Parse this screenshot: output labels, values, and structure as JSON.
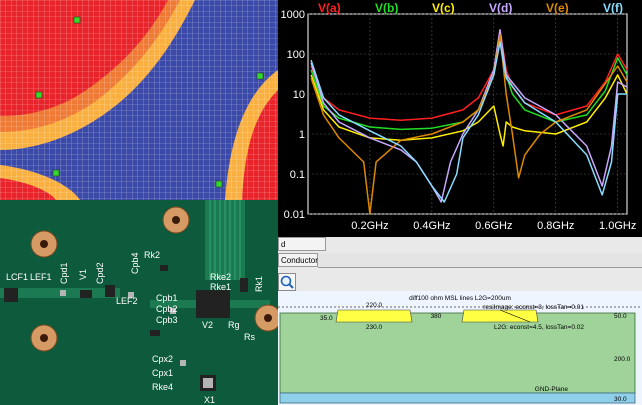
{
  "chart_data": {
    "type": "line",
    "title": "",
    "xlabel": "",
    "ylabel": "",
    "x_tick_labels": [
      "0.2GHz",
      "0.4GHz",
      "0.6GHz",
      "0.8GHz",
      "1.0GHz"
    ],
    "y_tick_labels": [
      "1000",
      "100",
      "10",
      "1",
      "0.1",
      "0.01"
    ],
    "xlim": [
      0.0,
      1.03
    ],
    "ylim": [
      0.01,
      1000
    ],
    "log_y": true,
    "grid": true,
    "legend_position": "top",
    "series": [
      {
        "name": "V(a)",
        "color": "#ff2020",
        "x": [
          0.01,
          0.05,
          0.1,
          0.2,
          0.3,
          0.4,
          0.5,
          0.55,
          0.6,
          0.62,
          0.64,
          0.66,
          0.7,
          0.8,
          0.9,
          0.96,
          1.0,
          1.03
        ],
        "y": [
          50,
          8,
          4,
          2.5,
          2.2,
          2.5,
          4,
          8,
          40,
          400,
          40,
          15,
          6,
          3,
          5,
          20,
          100,
          40
        ]
      },
      {
        "name": "V(b)",
        "color": "#22dd22",
        "x": [
          0.01,
          0.05,
          0.1,
          0.2,
          0.3,
          0.4,
          0.5,
          0.55,
          0.6,
          0.62,
          0.64,
          0.66,
          0.7,
          0.8,
          0.9,
          0.96,
          1.0,
          1.03
        ],
        "y": [
          40,
          5,
          2.5,
          1.5,
          1.3,
          1.4,
          2,
          4,
          30,
          300,
          30,
          10,
          4,
          2,
          3,
          12,
          80,
          30
        ]
      },
      {
        "name": "V(c)",
        "color": "#ffee00",
        "x": [
          0.01,
          0.05,
          0.1,
          0.2,
          0.3,
          0.4,
          0.5,
          0.55,
          0.6,
          0.62,
          0.63,
          0.64,
          0.66,
          0.7,
          0.8,
          0.9,
          0.96,
          1.0,
          1.03
        ],
        "y": [
          30,
          4,
          1.5,
          0.8,
          0.7,
          0.8,
          1.2,
          2,
          5,
          1,
          0.5,
          2,
          1.5,
          1.2,
          1,
          2,
          8,
          30,
          10
        ]
      },
      {
        "name": "V(d)",
        "color": "#c8a8ff",
        "x": [
          0.01,
          0.05,
          0.1,
          0.2,
          0.3,
          0.35,
          0.4,
          0.43,
          0.46,
          0.5,
          0.55,
          0.6,
          0.62,
          0.64,
          0.7,
          0.8,
          0.9,
          0.95,
          0.98,
          1.0,
          1.03
        ],
        "y": [
          60,
          6,
          2,
          0.8,
          0.4,
          0.2,
          0.05,
          0.02,
          0.2,
          1,
          4,
          40,
          400,
          30,
          8,
          3,
          0.5,
          0.05,
          0.5,
          20,
          15
        ]
      },
      {
        "name": "V(e)",
        "color": "#dd8800",
        "x": [
          0.01,
          0.05,
          0.1,
          0.18,
          0.2,
          0.22,
          0.3,
          0.4,
          0.5,
          0.55,
          0.6,
          0.62,
          0.64,
          0.66,
          0.68,
          0.7,
          0.75,
          0.8,
          0.9,
          1.0,
          1.03
        ],
        "y": [
          25,
          3,
          0.8,
          0.2,
          0.01,
          0.2,
          0.7,
          1,
          2,
          4,
          30,
          300,
          10,
          1,
          0.08,
          0.3,
          1,
          2,
          4,
          50,
          20
        ]
      },
      {
        "name": "V(f)",
        "color": "#88ddff",
        "x": [
          0.01,
          0.05,
          0.1,
          0.2,
          0.3,
          0.35,
          0.4,
          0.44,
          0.48,
          0.5,
          0.55,
          0.6,
          0.62,
          0.64,
          0.7,
          0.8,
          0.9,
          0.95,
          0.98,
          1.0,
          1.03
        ],
        "y": [
          70,
          8,
          3,
          1.2,
          0.5,
          0.2,
          0.05,
          0.02,
          0.1,
          0.8,
          3,
          30,
          200,
          25,
          6,
          2,
          0.3,
          0.03,
          0.2,
          10,
          10
        ]
      }
    ]
  },
  "heatmap": {
    "grid_color": "#ffffff",
    "colors": {
      "hot": "#e8232a",
      "warm": "#f9b040",
      "cool": "#3b49a8",
      "marker": "#39d62e"
    }
  },
  "pcb": {
    "labels": {
      "lcf1": "LCF1",
      "lef1": "LEF1",
      "cpd1": "Cpd1",
      "v1": "V1",
      "cpd2": "Cpd2",
      "lef2": "LEF2",
      "cpb4": "Cpb4",
      "rk2": "Rk2",
      "rke2": "Rke2",
      "rke1": "Rke1",
      "rk1": "Rk1",
      "cpb1": "Cpb1",
      "cpb2": "Cpb2",
      "cpb3": "Cpb3",
      "v2": "V2",
      "rg": "Rg",
      "cpx2": "Cpx2",
      "cpx1": "Cpx1",
      "rke4": "Rke4",
      "x1": "X1",
      "rs": "Rs"
    },
    "colors": {
      "board": "#0e5a3c",
      "pad": "#d69a64",
      "silkscreen": "#ffffff"
    }
  },
  "cad": {
    "tab_conductors_1": "d Conductors",
    "tab_conductors_2": "Conductors",
    "tool_icon": "search-icon",
    "stackup_title": "diff100 ohm  MSL lines  L2G=200um",
    "dim_220": "220.0",
    "dim_350": "35.0",
    "dim_380": "380",
    "dim_230": "230.0",
    "dim_500": "50.0",
    "dim_2000": "200.0",
    "dim_300": "30.0",
    "air_label": "resiImage: econst=3, lossTan=0.01",
    "dielectric_label": "L2G: econst=4.5, lossTan=0.02",
    "ground_label": "GND-Plane",
    "colors": {
      "dielectric": "#9fd39a",
      "trace": "#ffff44",
      "ground": "#8fd0e8"
    }
  }
}
